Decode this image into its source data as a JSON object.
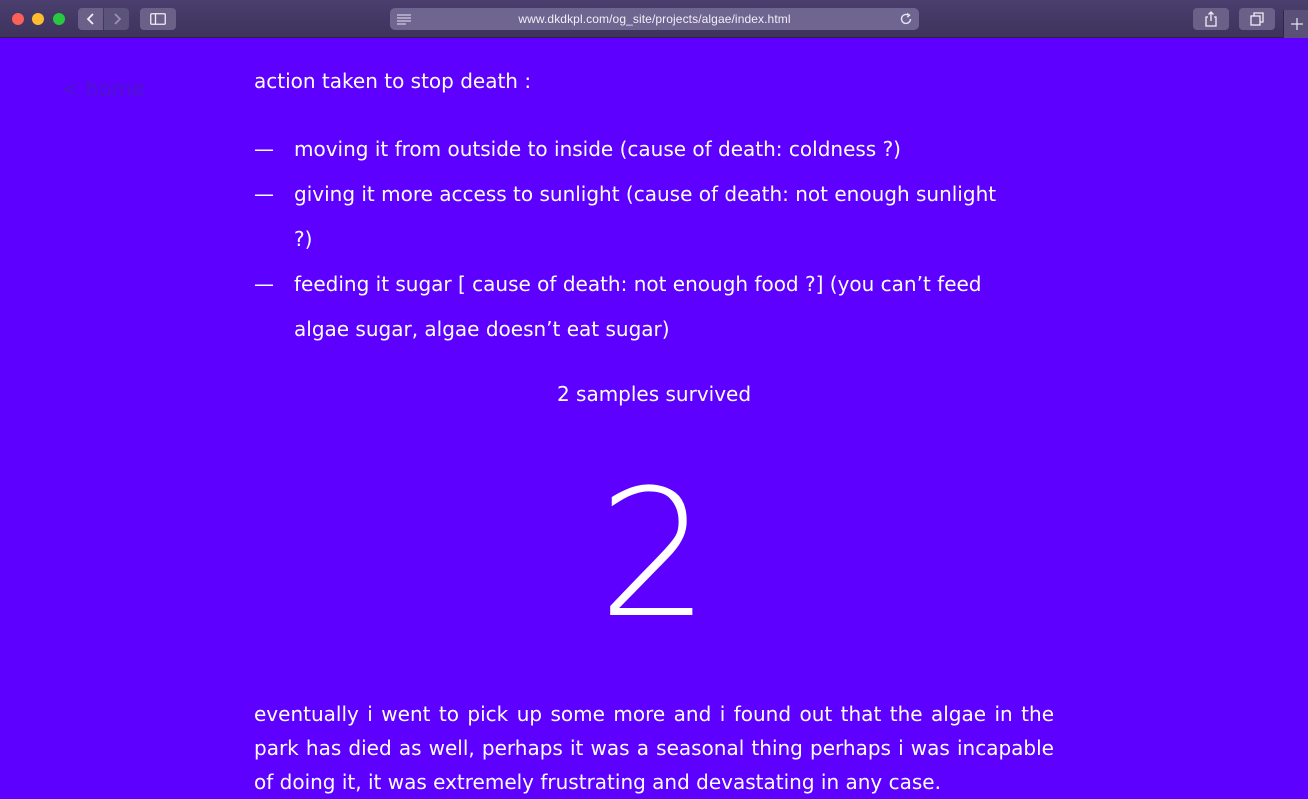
{
  "browser": {
    "url": "www.dkdkpl.com/og_site/projects/algae/index.html"
  },
  "page": {
    "home_link": "< home",
    "heading": "action taken to stop death :",
    "actions": [
      {
        "dash": "—",
        "text": "moving it from outside to inside (cause of death: coldness ?)"
      },
      {
        "dash": "—",
        "text": "giving it more access to sunlight (cause of death: not enough sunlight ?)"
      },
      {
        "dash": "—",
        "text": "feeding it sugar [ cause of death: not enough food ?] (you can’t feed algae sugar, algae doesn’t eat sugar)"
      }
    ],
    "survived_label": "2 samples survived",
    "survived_count": "2",
    "paragraph": "eventually i went to pick up some more and i found out that the algae in the park has died as well, perhaps it was a seasonal thing perhaps i was incapable of doing it, it was extremely frustrating and devastating in any case."
  },
  "colors": {
    "background": "#5e00ff",
    "text": "#ffffff",
    "home_link": "#4d14c9"
  }
}
